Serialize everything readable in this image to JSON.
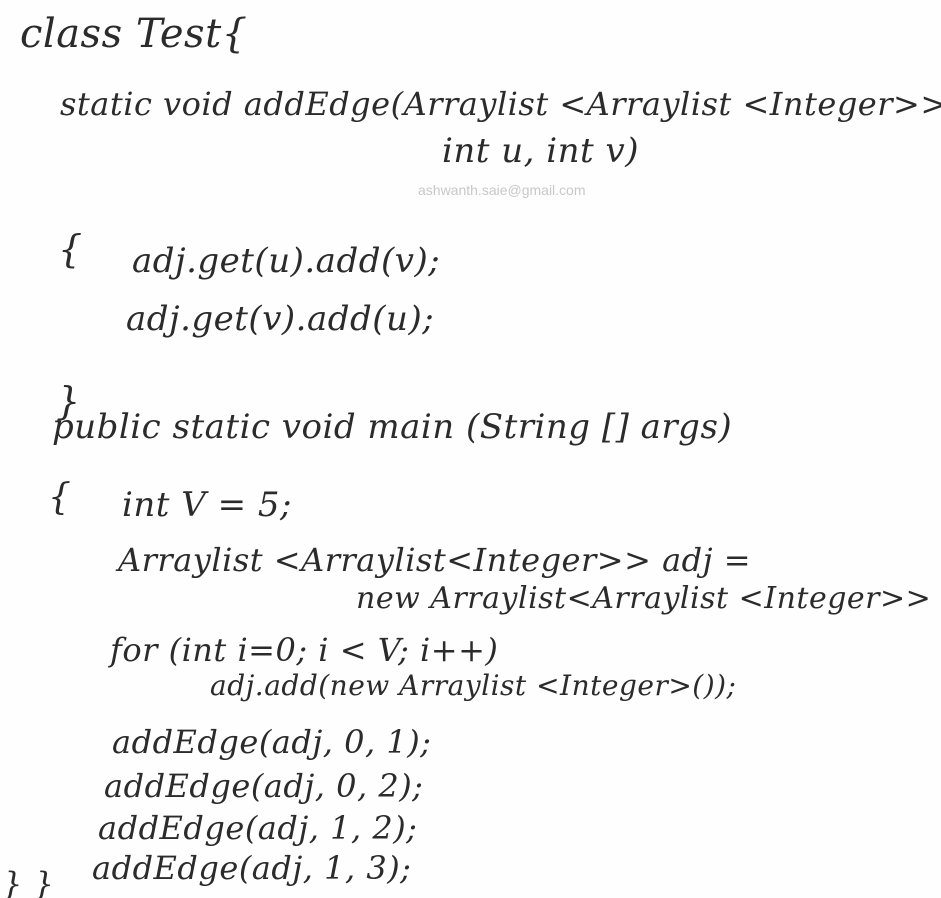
{
  "watermark": "ashwanth.saie@gmail.com",
  "code_lines": [
    "class Test{",
    "static void addEdge(Arraylist <Arraylist <Integer>> adj,",
    "int u, int v)",
    "{",
    "adj.get(u).add(v);",
    "adj.get(v).add(u);",
    "}",
    "public static void main (String [] args)",
    "{",
    "int V = 5;",
    "Arraylist <Arraylist<Integer>> adj =",
    "new Arraylist<Arraylist <Integer>> (V);",
    "for (int i=0; i < V; i++)",
    "adj.add(new Arraylist <Integer>());",
    "addEdge(adj, 0, 1);",
    "addEdge(adj, 0, 2);",
    "addEdge(adj, 1, 2);",
    "addEdge(adj, 1, 3);",
    "} }"
  ]
}
